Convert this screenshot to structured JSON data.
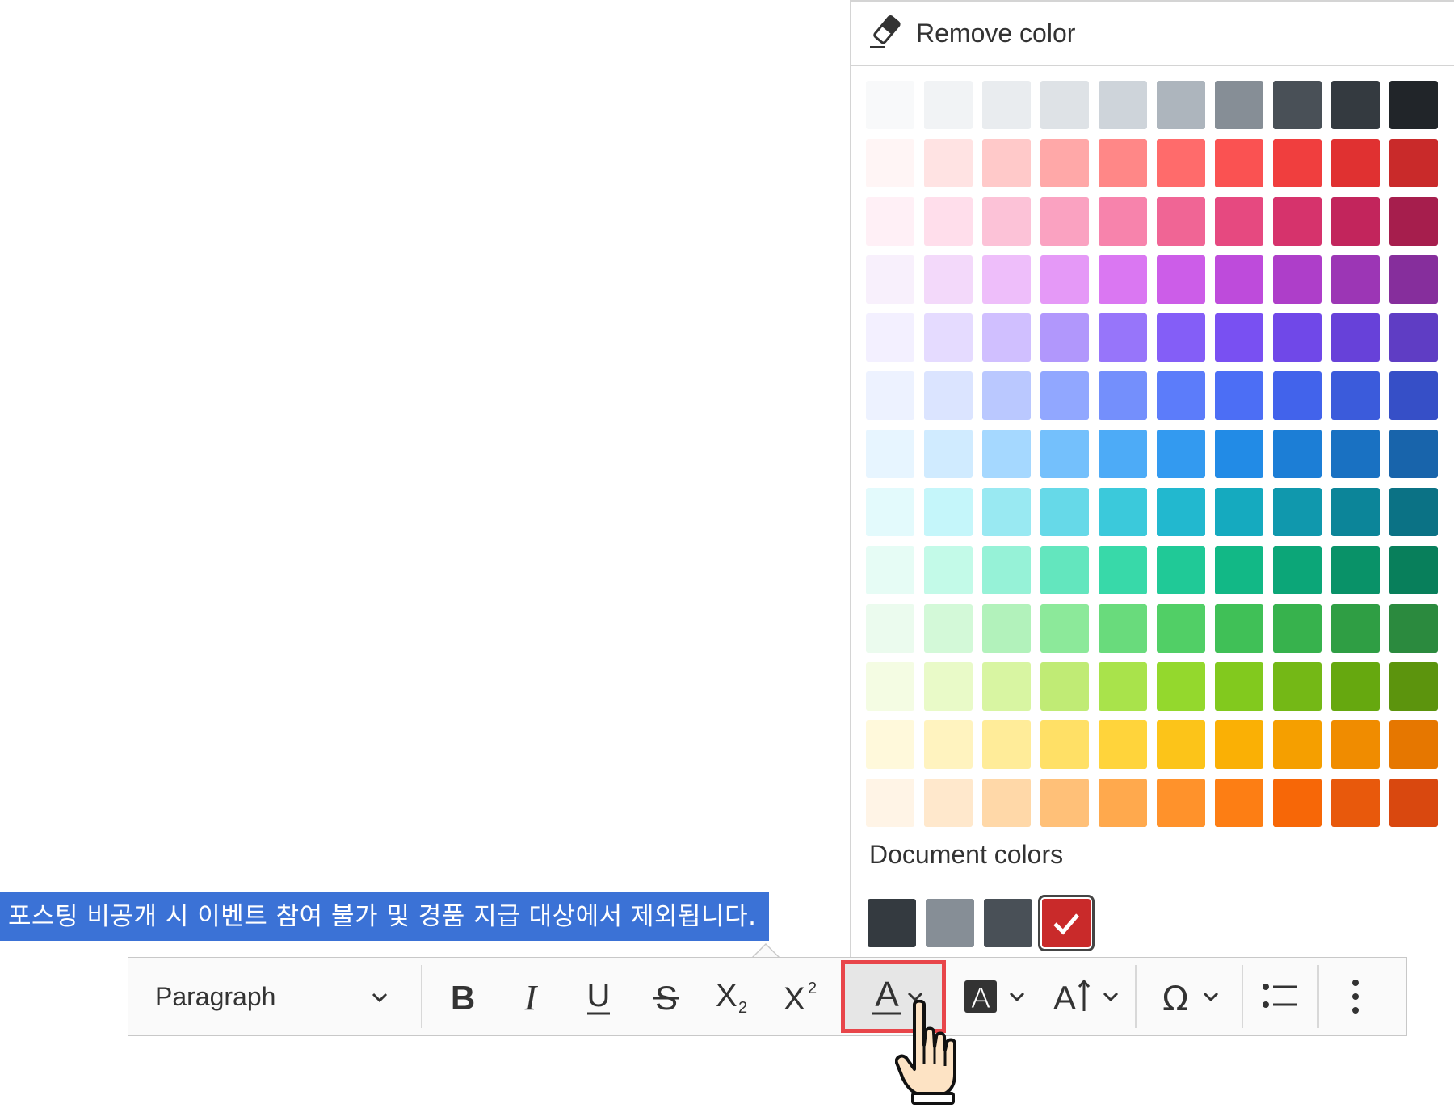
{
  "editor": {
    "selected_text": "포스팅 비공개 시 이벤트 참여 불가 및 경품 지급 대상에서 제외됩니다."
  },
  "toolbar": {
    "heading_label": "Paragraph",
    "buttons": [
      {
        "name": "bold",
        "icon": "bold-icon"
      },
      {
        "name": "italic",
        "icon": "italic-icon"
      },
      {
        "name": "underline",
        "icon": "underline-icon"
      },
      {
        "name": "strikethrough",
        "icon": "strikethrough-icon"
      },
      {
        "name": "subscript",
        "icon": "subscript-icon"
      },
      {
        "name": "superscript",
        "icon": "superscript-icon"
      },
      {
        "name": "font-color",
        "icon": "font-color-icon",
        "highlighted": true
      },
      {
        "name": "font-background-color",
        "icon": "font-background-color-icon"
      },
      {
        "name": "font-size",
        "icon": "font-size-icon"
      },
      {
        "name": "special-characters",
        "icon": "omega-icon"
      },
      {
        "name": "bulleted-list",
        "icon": "bulleted-list-icon"
      },
      {
        "name": "more",
        "icon": "more-vertical-icon"
      }
    ]
  },
  "color_panel": {
    "remove_label": "Remove color",
    "remove_icon": "eraser-icon",
    "colors": [
      [
        "#f8f9fa",
        "#f1f3f5",
        "#e9ecef",
        "#dee2e6",
        "#ced4da",
        "#adb5bd",
        "#868e96",
        "#495057",
        "#343a40",
        "#212529"
      ],
      [
        "#fff5f5",
        "#ffe3e3",
        "#ffc9c9",
        "#ffa8a8",
        "#ff8787",
        "#ff6b6b",
        "#fa5252",
        "#f03e3e",
        "#e03131",
        "#c92a2a"
      ],
      [
        "#fff0f6",
        "#ffdeeb",
        "#fcc2d7",
        "#faa2c1",
        "#f783ac",
        "#f06595",
        "#e64980",
        "#d6336c",
        "#c2255c",
        "#a61e4d"
      ],
      [
        "#f8f0fc",
        "#f3d9fa",
        "#eebefa",
        "#e599f7",
        "#da77f2",
        "#cc5de8",
        "#be4bdb",
        "#ae3ec9",
        "#9c36b5",
        "#862e9c"
      ],
      [
        "#f3f0ff",
        "#e5dbff",
        "#d0bfff",
        "#b197fc",
        "#9775fa",
        "#845ef7",
        "#7950f2",
        "#7048e8",
        "#6741d9",
        "#5f3dc4"
      ],
      [
        "#edf2ff",
        "#dbe4ff",
        "#bac8ff",
        "#91a7ff",
        "#748ffc",
        "#5c7cfa",
        "#4c6ef5",
        "#4263eb",
        "#3b5bdb",
        "#364fc7"
      ],
      [
        "#e7f5ff",
        "#d0ebff",
        "#a5d8ff",
        "#74c0fc",
        "#4dabf7",
        "#339af0",
        "#228be6",
        "#1c7ed6",
        "#1971c2",
        "#1864ab"
      ],
      [
        "#e3fafc",
        "#c5f6fa",
        "#99e9f2",
        "#66d9e8",
        "#3bc9db",
        "#22b8cf",
        "#15aabf",
        "#1098ad",
        "#0c8599",
        "#0b7285"
      ],
      [
        "#e6fcf5",
        "#c3fae8",
        "#96f2d7",
        "#63e6be",
        "#38d9a9",
        "#20c997",
        "#12b886",
        "#0ca678",
        "#099268",
        "#087f5b"
      ],
      [
        "#ebfbee",
        "#d3f9d8",
        "#b2f2bb",
        "#8ce99a",
        "#69db7c",
        "#51cf66",
        "#40c057",
        "#37b24d",
        "#2f9e44",
        "#2b8a3e"
      ],
      [
        "#f4fce3",
        "#e9fac8",
        "#d8f5a2",
        "#c0eb75",
        "#a9e34b",
        "#94d82d",
        "#82c91e",
        "#74b816",
        "#66a80f",
        "#5c940d"
      ],
      [
        "#fff9db",
        "#fff3bf",
        "#ffec99",
        "#ffe066",
        "#ffd43b",
        "#fcc419",
        "#fab005",
        "#f59f00",
        "#f08c00",
        "#e67700"
      ],
      [
        "#fff4e6",
        "#ffe8cc",
        "#ffd8a8",
        "#ffc078",
        "#ffa94d",
        "#ff922b",
        "#fd7e14",
        "#f76707",
        "#e8590c",
        "#d9480f"
      ]
    ],
    "document_colors_label": "Document colors",
    "document_colors": [
      "#343a40",
      "#868e96",
      "#495057",
      "#c92a2a"
    ],
    "selected_document_color_index": 3
  },
  "cursor": {
    "icon": "hand-pointer-icon"
  }
}
